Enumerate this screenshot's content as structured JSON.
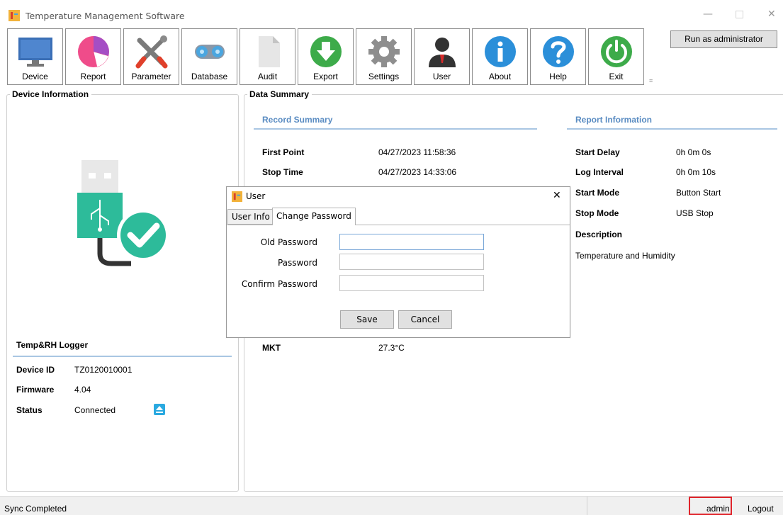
{
  "window": {
    "title": "Temperature Management Software",
    "min": "—",
    "max": "□",
    "close": "✕"
  },
  "toolbar": {
    "buttons": [
      {
        "label": "Device",
        "icon": "monitor-icon"
      },
      {
        "label": "Report",
        "icon": "pie-chart-icon"
      },
      {
        "label": "Parameter",
        "icon": "tools-icon"
      },
      {
        "label": "Database",
        "icon": "binoculars-icon"
      },
      {
        "label": "Audit",
        "icon": "document-icon"
      },
      {
        "label": "Export",
        "icon": "export-icon"
      },
      {
        "label": "Settings",
        "icon": "gear-icon"
      },
      {
        "label": "User",
        "icon": "user-icon"
      },
      {
        "label": "About",
        "icon": "info-icon"
      },
      {
        "label": "Help",
        "icon": "help-icon"
      },
      {
        "label": "Exit",
        "icon": "power-icon"
      }
    ],
    "overflow": "=",
    "run_as_admin": "Run as administrator"
  },
  "device_panel": {
    "title": "Device Information",
    "logger_title": "Temp&RH Logger",
    "rows": [
      {
        "label": "Device ID",
        "value": "TZ0120010001"
      },
      {
        "label": "Firmware",
        "value": "4.04"
      },
      {
        "label": "Status",
        "value": "Connected"
      }
    ]
  },
  "summary_panel": {
    "title": "Data Summary",
    "record_title": "Record Summary",
    "record_rows": [
      {
        "label": "First Point",
        "value": "04/27/2023 11:58:36"
      },
      {
        "label": "Stop Time",
        "value": "04/27/2023 14:33:06"
      }
    ],
    "mkt_label": "MKT",
    "mkt_value": "27.3°C",
    "report_title": "Report Information",
    "report_rows": [
      {
        "label": "Start Delay",
        "value": "0h 0m 0s"
      },
      {
        "label": "Log Interval",
        "value": "0h 0m 10s"
      },
      {
        "label": "Start Mode",
        "value": "Button Start"
      },
      {
        "label": "Stop Mode",
        "value": "USB Stop"
      }
    ],
    "description_label": "Description",
    "description_value": "Temperature and Humidity"
  },
  "dialog": {
    "title": "User",
    "close": "✕",
    "tabs": [
      "User Info",
      "Change Password"
    ],
    "active_tab": "Change Password",
    "fields": [
      {
        "label": "Old Password",
        "value": ""
      },
      {
        "label": "Password",
        "value": ""
      },
      {
        "label": "Confirm Password",
        "value": ""
      }
    ],
    "save": "Save",
    "cancel": "Cancel"
  },
  "statusbar": {
    "status": "Sync Completed",
    "user": "admin",
    "logout": "Logout"
  },
  "colors": {
    "accent": "#5a8cc2",
    "highlight": "#e0242b",
    "usb_green": "#2dbb9a"
  }
}
